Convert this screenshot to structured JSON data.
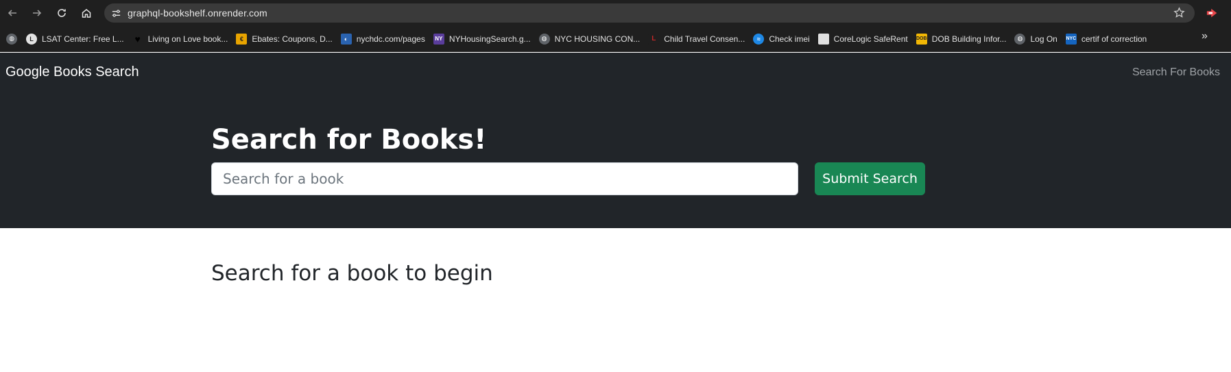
{
  "browser": {
    "url": "graphql-bookshelf.onrender.com",
    "bookmarks": [
      {
        "label": "",
        "icon": "globe-icon",
        "color": "#5f6368"
      },
      {
        "label": "LSAT Center: Free L...",
        "icon": "lsat-icon",
        "color": "#1a73e8"
      },
      {
        "label": "Living on Love book...",
        "icon": "heart-icon",
        "color": "#000000"
      },
      {
        "label": "Ebates: Coupons, D...",
        "icon": "ebates-icon",
        "color": "#e8a400"
      },
      {
        "label": "nychdc.com/pages",
        "icon": "nychdc-icon",
        "color": "#2a63b0"
      },
      {
        "label": "NYHousingSearch.g...",
        "icon": "ny-icon",
        "color": "#5a3d9c"
      },
      {
        "label": "NYC HOUSING CON...",
        "icon": "globe-icon",
        "color": "#5f6368"
      },
      {
        "label": "Child Travel Consen...",
        "icon": "lc-icon",
        "color": "#8b1a1a"
      },
      {
        "label": "Check imei",
        "icon": "imei-icon",
        "color": "#1e88e5"
      },
      {
        "label": "CoreLogic SafeRent",
        "icon": "document-icon",
        "color": "#e0e0e0"
      },
      {
        "label": "DOB Building Infor...",
        "icon": "dob-icon",
        "color": "#f2b705"
      },
      {
        "label": "Log On",
        "icon": "globe-icon",
        "color": "#5f6368"
      },
      {
        "label": "certif of correction",
        "icon": "nyc-icon",
        "color": "#1565c0"
      }
    ]
  },
  "navbar": {
    "brand": "Google Books Search",
    "link": "Search For Books"
  },
  "hero": {
    "title": "Search for Books!",
    "search_placeholder": "Search for a book",
    "submit_label": "Submit Search"
  },
  "results": {
    "heading": "Search for a book to begin"
  },
  "colors": {
    "navbar_bg": "#212529",
    "submit_bg": "#198754",
    "browser_bg": "#1f1f1f"
  }
}
